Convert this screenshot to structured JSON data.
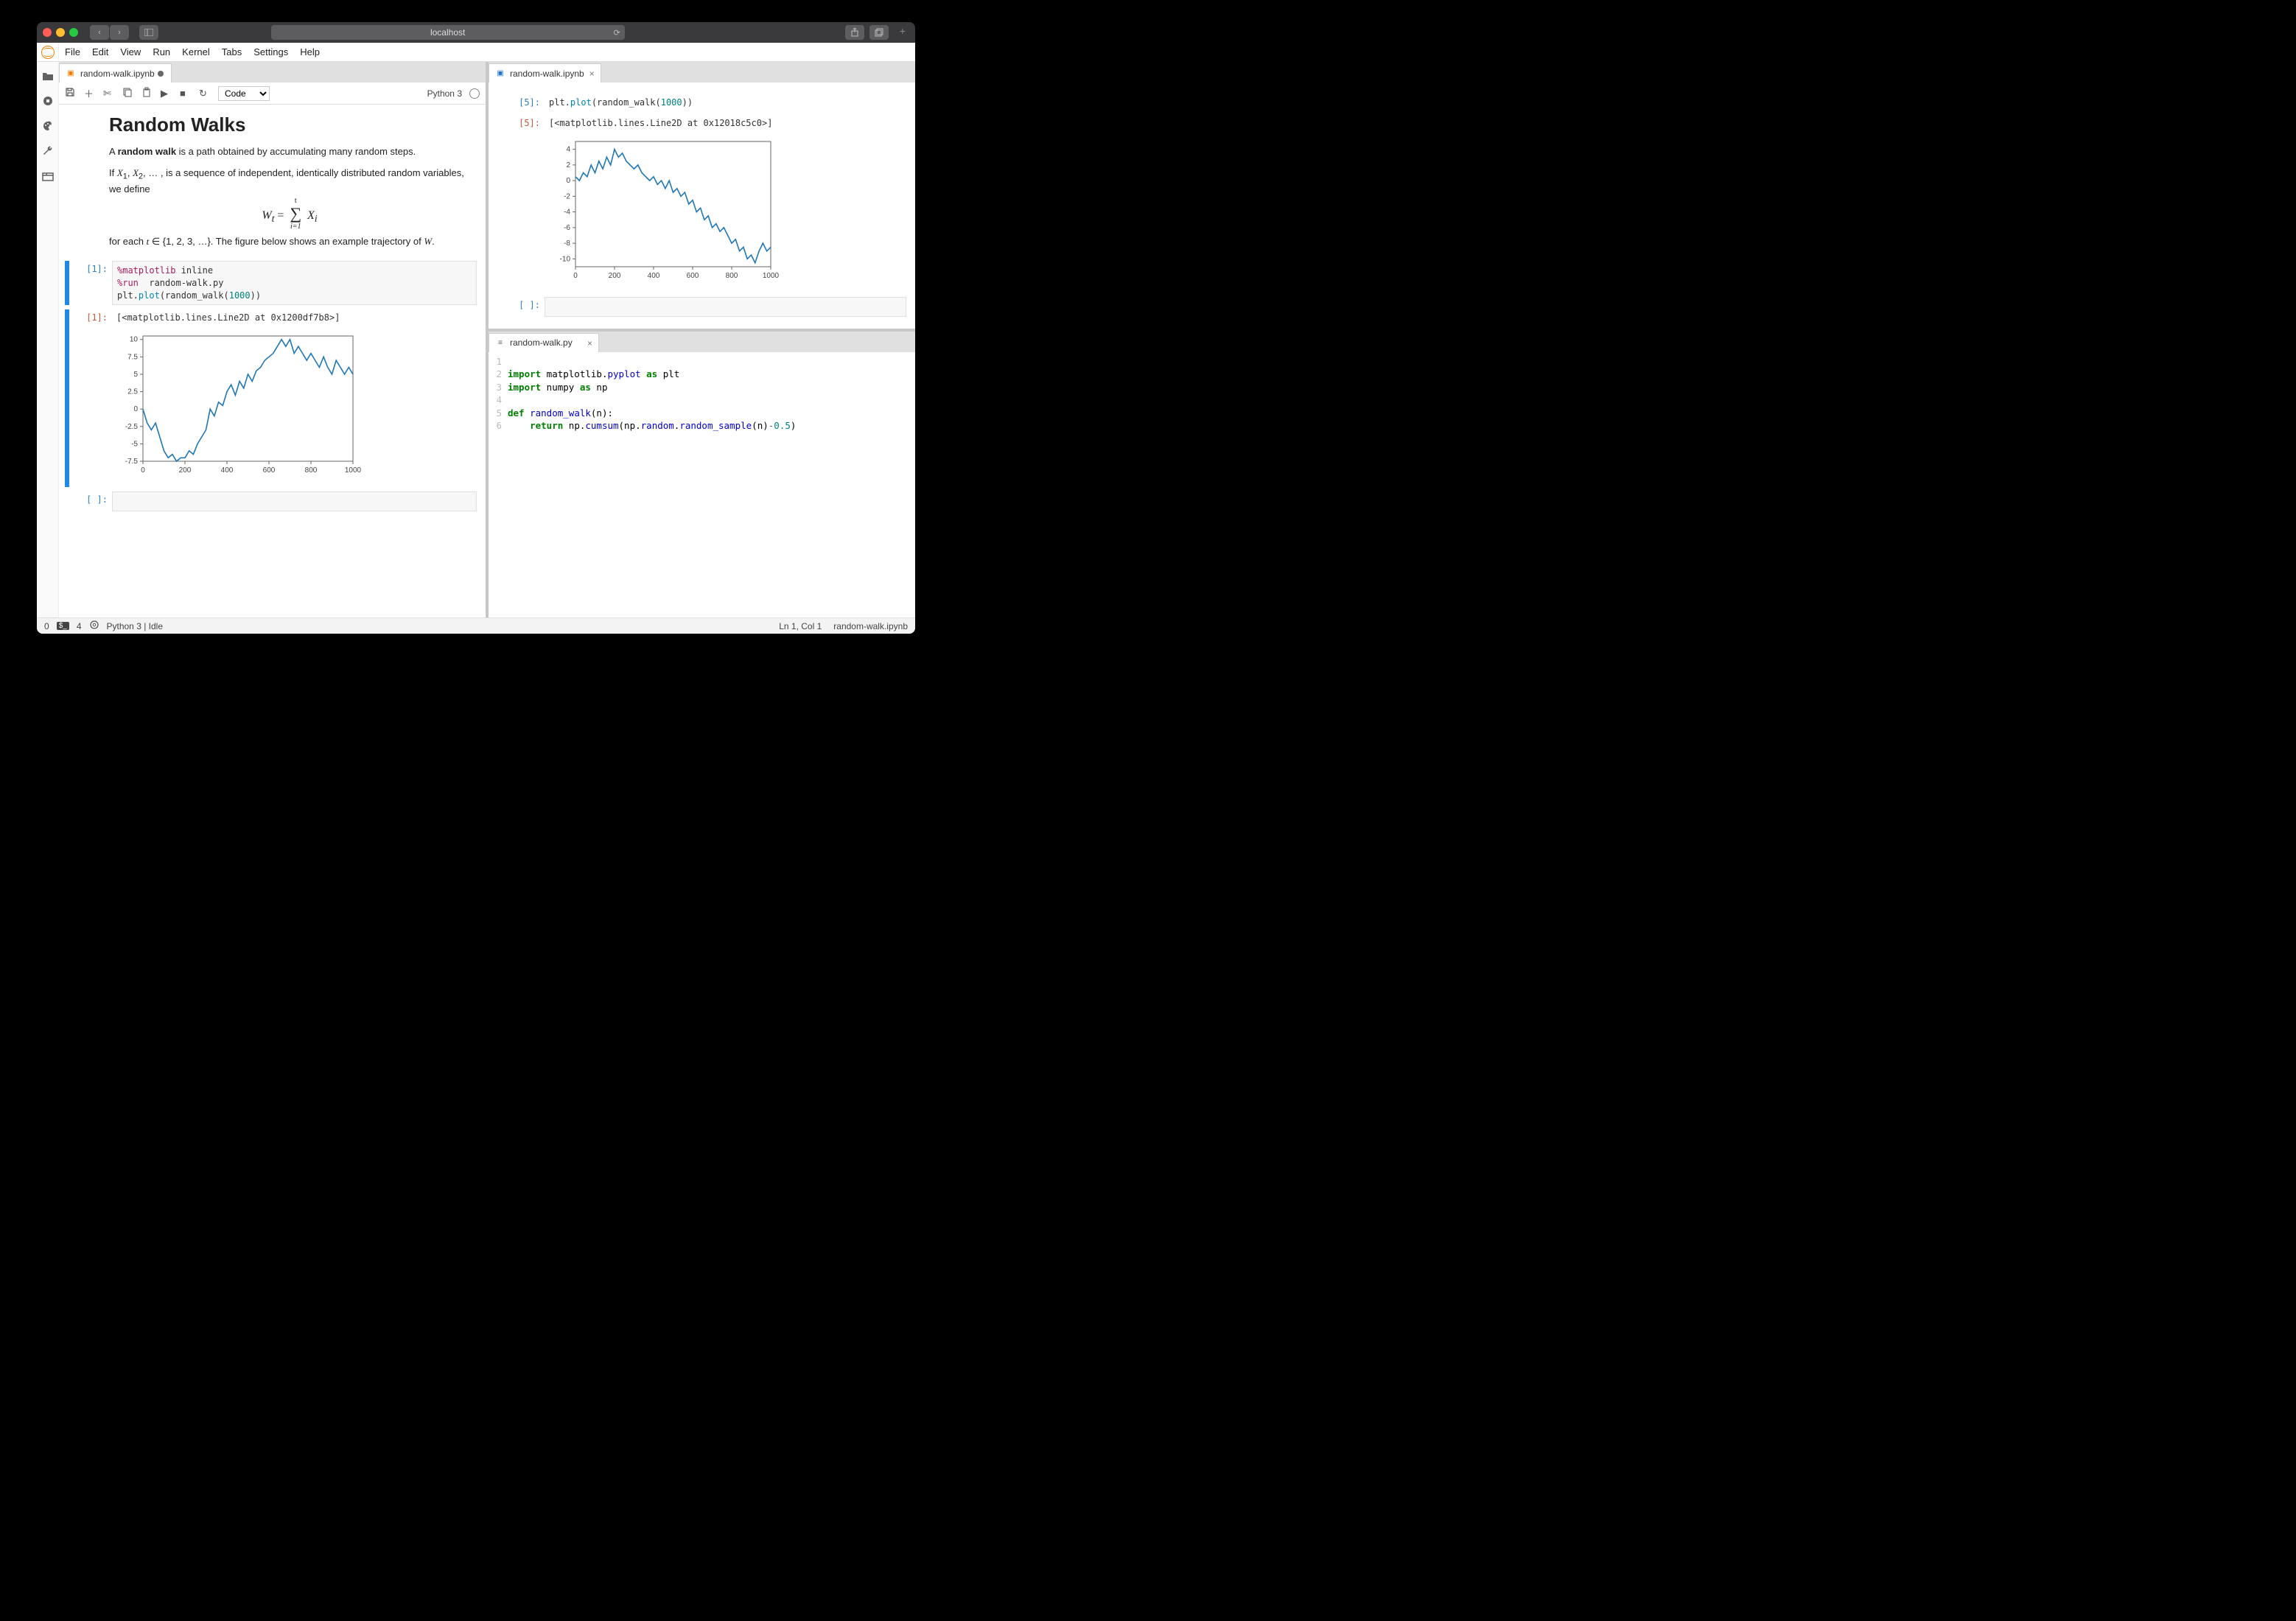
{
  "browser": {
    "address": "localhost"
  },
  "menu": {
    "items": [
      "File",
      "Edit",
      "View",
      "Run",
      "Kernel",
      "Tabs",
      "Settings",
      "Help"
    ]
  },
  "leftpane": {
    "tab": {
      "filename": "random-walk.ipynb",
      "dirty": true
    },
    "toolbar": {
      "celltype": "Code",
      "kernel": "Python 3"
    },
    "md": {
      "heading": "Random Walks",
      "p1a": "A ",
      "p1b": "random walk",
      "p1c": " is a path obtained by accumulating many random steps.",
      "p2": "If X₁, X₂, … , is a sequence of independent, identically distributed random variables, we define",
      "formula_lhs": "W",
      "formula_sub_t": "t",
      "formula_eq": " = ",
      "formula_top": "t",
      "formula_bot": "i=1",
      "formula_rhs": "X",
      "formula_rhs_sub": "i",
      "p3": "for each t ∈ {1, 2, 3, …}. The figure below shows an example trajectory of W."
    },
    "cell_in_prompt": "[1]:",
    "cell_in_lines": {
      "l1a": "%matplotlib",
      "l1b": " inline",
      "l2a": "%run",
      "l2b": "  random-walk.py",
      "l3a": "plt.",
      "l3b": "plot",
      "l3c": "(random_walk(",
      "l3d": "1000",
      "l3e": "))"
    },
    "cell_out_prompt": "[1]:",
    "cell_out_text": "[<matplotlib.lines.Line2D at 0x1200df7b8>]",
    "empty_prompt": "[ ]:"
  },
  "rightpane": {
    "top_tab": {
      "filename": "random-walk.ipynb"
    },
    "cell_in_prompt": "[5]:",
    "cell_in_lines": {
      "l1a": "plt.",
      "l1b": "plot",
      "l1c": "(random_walk(",
      "l1d": "1000",
      "l1e": "))"
    },
    "cell_out_prompt": "[5]:",
    "cell_out_text": "[<matplotlib.lines.Line2D at 0x12018c5c0>]",
    "empty_prompt": "[ ]:",
    "bottom_tab": {
      "filename": "random-walk.py"
    },
    "py": {
      "l1": "",
      "l2_import": "import",
      "l2_rest": " matplotlib.",
      "l2_mod": "pyplot",
      "l2_as": " as ",
      "l2_alias": "plt",
      "l3_import": "import",
      "l3_rest": " numpy ",
      "l3_as": "as ",
      "l3_alias": "np",
      "l4": "",
      "l5_def": "def ",
      "l5_name": "random_walk",
      "l5_rest": "(n):",
      "l6_ret": "    return ",
      "l6_a": "np.",
      "l6_b": "cumsum",
      "l6_c": "(np.",
      "l6_d": "random",
      "l6_e": ".",
      "l6_f": "random_sample",
      "l6_g": "(n)",
      "l6_h": "-",
      "l6_i": "0.5",
      "l6_j": ")"
    }
  },
  "status": {
    "left_count": "0",
    "terminals": "4",
    "kernel": "Python 3 | Idle",
    "right_pos": "Ln 1, Col 1",
    "right_file": "random-walk.ipynb"
  },
  "chart_data": [
    {
      "type": "line",
      "title": "",
      "xlabel": "",
      "ylabel": "",
      "xlim": [
        0,
        1000
      ],
      "ylim": [
        -7.5,
        10.5
      ],
      "xticks": [
        0,
        200,
        400,
        600,
        800,
        1000
      ],
      "yticks": [
        -7.5,
        -5.0,
        -2.5,
        0.0,
        2.5,
        5.0,
        7.5,
        10.0
      ],
      "x": [
        0,
        20,
        40,
        60,
        80,
        100,
        120,
        140,
        160,
        180,
        200,
        220,
        240,
        260,
        280,
        300,
        320,
        340,
        360,
        380,
        400,
        420,
        440,
        460,
        480,
        500,
        520,
        540,
        560,
        580,
        600,
        620,
        640,
        660,
        680,
        700,
        720,
        740,
        760,
        780,
        800,
        820,
        840,
        860,
        880,
        900,
        920,
        940,
        960,
        980,
        1000
      ],
      "y": [
        0.0,
        -2.0,
        -3.0,
        -2.0,
        -4.0,
        -6.0,
        -7.0,
        -6.5,
        -7.5,
        -7.0,
        -7.0,
        -6.0,
        -6.5,
        -5.0,
        -4.0,
        -3.0,
        0.0,
        -1.0,
        1.0,
        0.5,
        2.5,
        3.5,
        2.0,
        4.0,
        3.0,
        5.0,
        4.0,
        5.5,
        6.0,
        7.0,
        7.5,
        8.0,
        9.0,
        10.0,
        9.0,
        10.0,
        8.0,
        9.0,
        8.0,
        7.0,
        8.0,
        7.0,
        6.0,
        7.5,
        6.0,
        5.0,
        7.0,
        6.0,
        5.0,
        6.0,
        5.0
      ]
    },
    {
      "type": "line",
      "title": "",
      "xlabel": "",
      "ylabel": "",
      "xlim": [
        0,
        1000
      ],
      "ylim": [
        -11,
        5
      ],
      "xticks": [
        0,
        200,
        400,
        600,
        800,
        1000
      ],
      "yticks": [
        -10,
        -8,
        -6,
        -4,
        -2,
        0,
        2,
        4
      ],
      "x": [
        0,
        20,
        40,
        60,
        80,
        100,
        120,
        140,
        160,
        180,
        200,
        220,
        240,
        260,
        280,
        300,
        320,
        340,
        360,
        380,
        400,
        420,
        440,
        460,
        480,
        500,
        520,
        540,
        560,
        580,
        600,
        620,
        640,
        660,
        680,
        700,
        720,
        740,
        760,
        780,
        800,
        820,
        840,
        860,
        880,
        900,
        920,
        940,
        960,
        980,
        1000
      ],
      "y": [
        0.5,
        0.0,
        1.0,
        0.5,
        2.0,
        1.0,
        2.5,
        1.5,
        3.0,
        2.0,
        4.0,
        3.0,
        3.5,
        2.5,
        2.0,
        1.5,
        2.0,
        1.0,
        0.5,
        0.0,
        0.5,
        -0.5,
        0.0,
        -1.0,
        0.0,
        -1.5,
        -1.0,
        -2.0,
        -1.5,
        -3.0,
        -2.5,
        -4.0,
        -3.5,
        -5.0,
        -4.5,
        -6.0,
        -5.5,
        -6.5,
        -6.0,
        -7.0,
        -8.0,
        -7.5,
        -9.0,
        -8.5,
        -10.0,
        -9.5,
        -10.5,
        -9.0,
        -8.0,
        -9.0,
        -8.5
      ]
    }
  ]
}
